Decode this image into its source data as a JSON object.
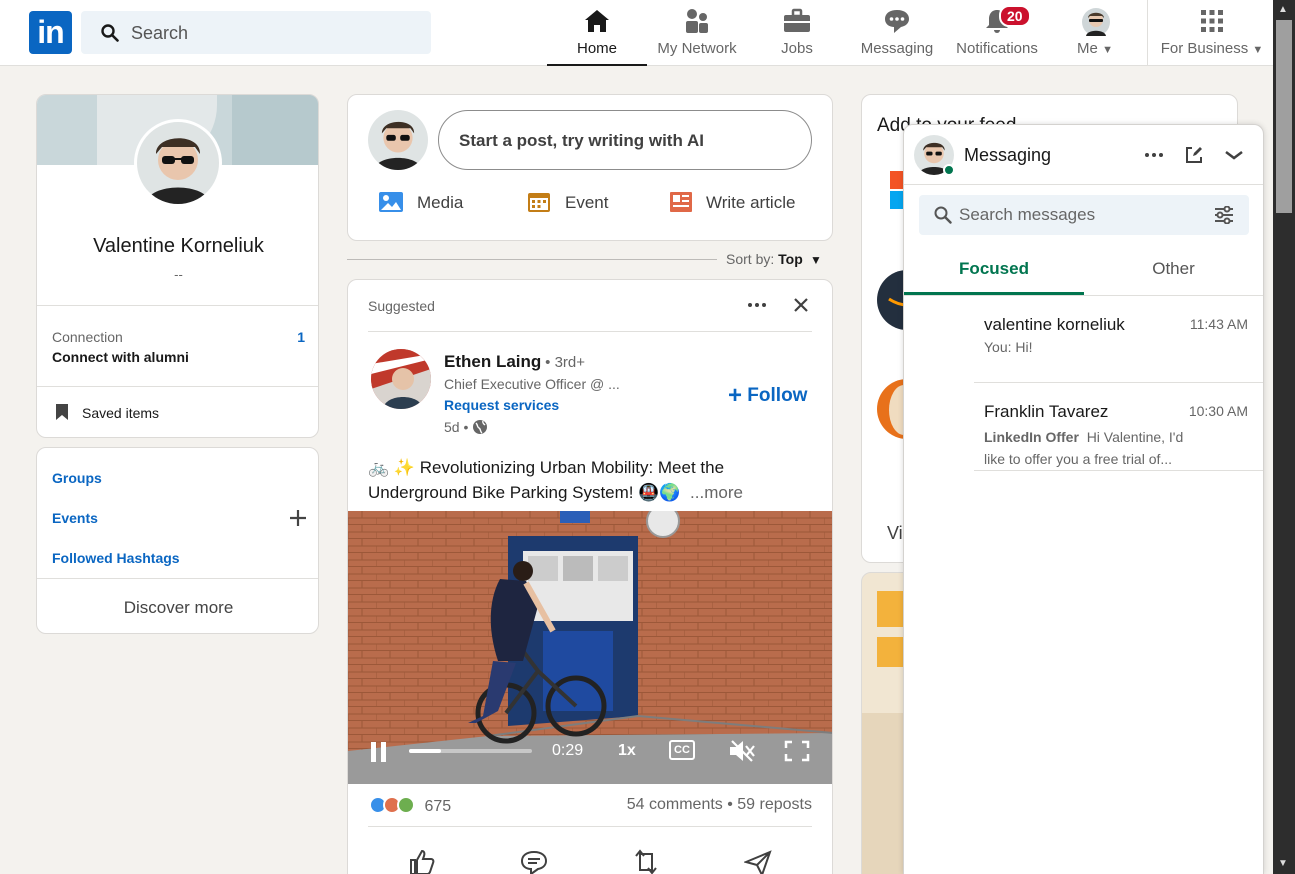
{
  "header": {
    "search_placeholder": "Search",
    "nav": [
      {
        "label": "Home",
        "icon": "home-icon"
      },
      {
        "label": "My Network",
        "icon": "network-icon"
      },
      {
        "label": "Jobs",
        "icon": "briefcase-icon"
      },
      {
        "label": "Messaging",
        "icon": "chat-icon"
      },
      {
        "label": "Notifications",
        "icon": "bell-icon"
      },
      {
        "label": "Me",
        "icon": "avatar"
      },
      {
        "label": "For Business",
        "icon": "grid-icon"
      }
    ],
    "notifications_count": "20",
    "logo_text": "in"
  },
  "profile": {
    "name": "Valentine Korneliuk",
    "headline": "--",
    "connection_label": "Connection",
    "connection_count": "1",
    "connection_sub": "Connect with alumni",
    "saved_items": "Saved items"
  },
  "shortcuts": {
    "groups": "Groups",
    "events": "Events",
    "hashtags": "Followed Hashtags",
    "discover": "Discover more"
  },
  "composer": {
    "placeholder": "Start a post, try writing with AI",
    "media": "Media",
    "event": "Event",
    "article": "Write article"
  },
  "sort": {
    "label": "Sort by:",
    "value": "Top"
  },
  "post": {
    "suggested": "Suggested",
    "author": "Ethen Laing",
    "degree": "• 3rd+",
    "title": "Chief Executive Officer @ ...",
    "link": "Request services",
    "time": "5d •",
    "follow": "Follow",
    "text_line1": "🚲 ✨ Revolutionizing Urban Mobility: Meet the",
    "text_line2": "Underground Bike Parking System! 🚇🌍",
    "more": "...more",
    "video_time": "0:29",
    "video_speed": "1x",
    "video_cc": "CC",
    "video_progress": 0.26,
    "reactions": "675",
    "comments": "54 comments • 59 reposts"
  },
  "right": {
    "feed_title": "Add to your feed",
    "view_text": "Vi"
  },
  "messaging": {
    "title": "Messaging",
    "search_placeholder": "Search messages",
    "tab_focused": "Focused",
    "tab_other": "Other",
    "conversations": [
      {
        "name": "valentine korneliuk",
        "time": "11:43 AM",
        "preview": "You: Hi!"
      },
      {
        "name": "Franklin Tavarez",
        "time": "10:30 AM",
        "tag": "LinkedIn Offer",
        "preview": "Hi Valentine, I'd",
        "preview2": "like to offer you a free trial of..."
      }
    ]
  },
  "colors": {
    "brand": "#0a66c2",
    "focused_green": "#01754f",
    "badge_red": "#cb112d"
  }
}
